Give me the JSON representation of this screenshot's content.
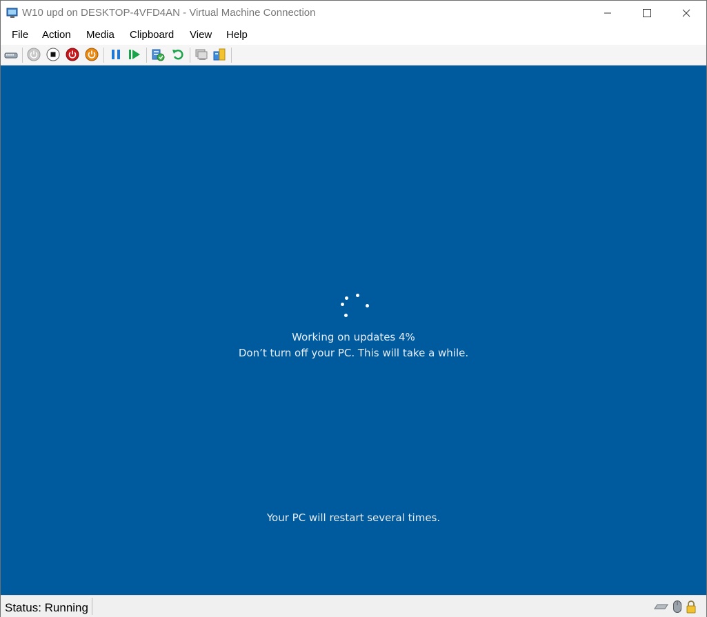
{
  "window": {
    "title": "W10 upd on DESKTOP-4VFD4AN - Virtual Machine Connection"
  },
  "menu": {
    "items": [
      {
        "label": "File"
      },
      {
        "label": "Action"
      },
      {
        "label": "Media"
      },
      {
        "label": "Clipboard"
      },
      {
        "label": "View"
      },
      {
        "label": "Help"
      }
    ]
  },
  "toolbar": {
    "icons": [
      "ctrl-alt-del-icon",
      "start-icon",
      "turn-off-icon",
      "shutdown-icon",
      "save-icon",
      "pause-icon",
      "resume-icon",
      "checkpoint-icon",
      "revert-icon",
      "enhanced-session-icon",
      "share-icon"
    ]
  },
  "vm": {
    "progress_line": "Working on updates  4%",
    "warning_line": "Don’t turn off your PC. This will take a while.",
    "restart_line": "Your PC will restart several times.",
    "background_color": "#005a9e"
  },
  "status": {
    "text": "Status: Running"
  },
  "tray": {
    "icons": [
      "keyboard-icon",
      "mouse-icon",
      "lock-icon"
    ]
  }
}
